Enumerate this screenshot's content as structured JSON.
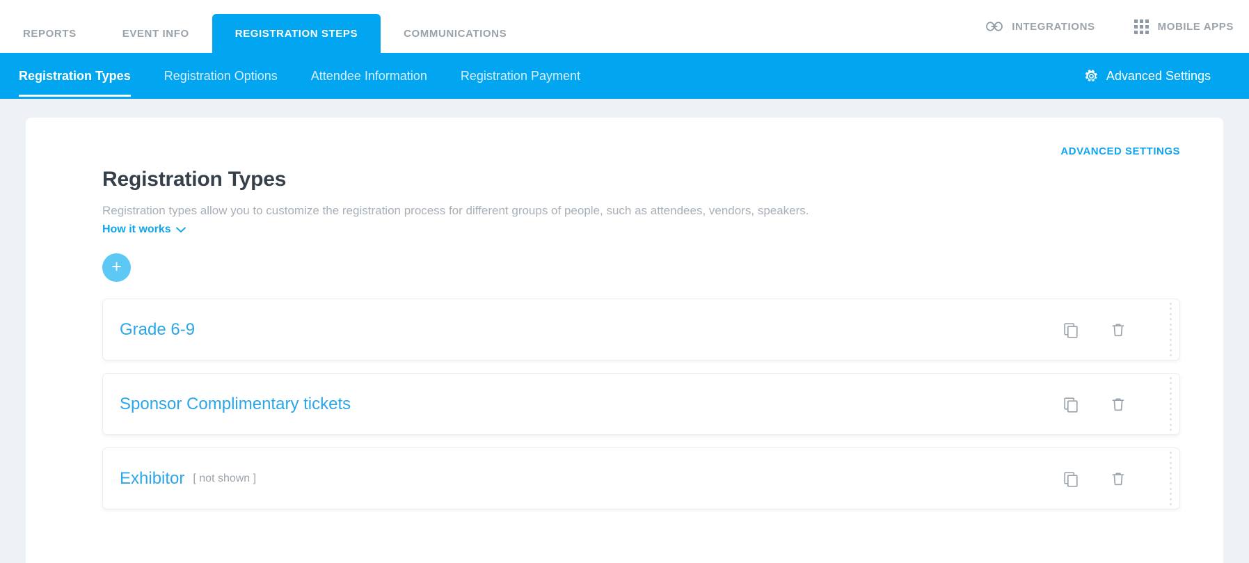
{
  "topnav": {
    "tabs": [
      {
        "label": "REPORTS",
        "active": false
      },
      {
        "label": "EVENT INFO",
        "active": false
      },
      {
        "label": "REGISTRATION STEPS",
        "active": true
      },
      {
        "label": "COMMUNICATIONS",
        "active": false
      }
    ],
    "integrations_label": "INTEGRATIONS",
    "mobile_apps_label": "MOBILE APPS"
  },
  "subnav": {
    "tabs": [
      {
        "label": "Registration Types",
        "active": true
      },
      {
        "label": "Registration Options",
        "active": false
      },
      {
        "label": "Attendee Information",
        "active": false
      },
      {
        "label": "Registration Payment",
        "active": false
      }
    ],
    "advanced_settings_label": "Advanced Settings"
  },
  "panel": {
    "advanced_settings_link": "ADVANCED SETTINGS",
    "title": "Registration Types",
    "description": "Registration types allow you to customize the registration process for different groups of people, such as attendees, vendors, speakers.",
    "how_it_works_label": "How it works",
    "add_button_label": "+",
    "cards": [
      {
        "label": "Grade 6-9",
        "note": ""
      },
      {
        "label": "Sponsor Complimentary tickets",
        "note": ""
      },
      {
        "label": "Exhibitor",
        "note": "[ not shown ]"
      }
    ]
  },
  "colors": {
    "accent_blue": "#02a5ef",
    "link_blue": "#12a5ef",
    "page_bg": "#eef1f5",
    "title_gray": "#36404a",
    "muted_gray": "#a8b0b8"
  }
}
